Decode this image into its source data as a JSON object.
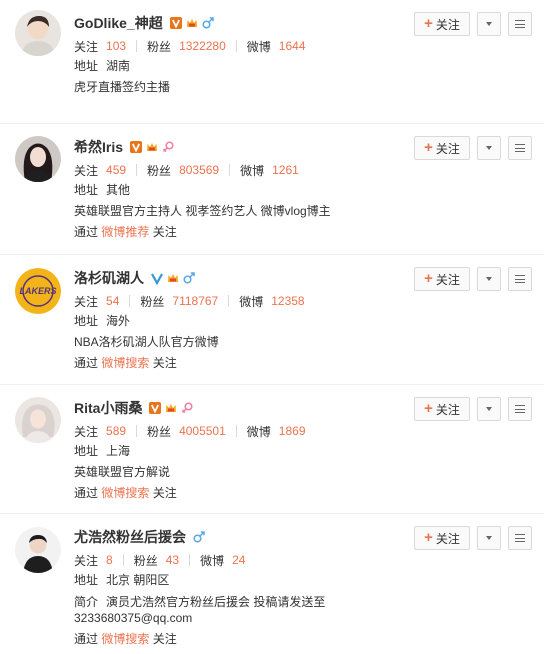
{
  "actions": {
    "follow_label": "关注"
  },
  "labels": {
    "follows": "关注",
    "fans": "粉丝",
    "posts": "微博",
    "location": "地址",
    "intro": "简介",
    "via": "通过",
    "follow_suffix": "关注"
  },
  "users": [
    {
      "name": "GoDlike_神超",
      "follows": "103",
      "fans": "1322280",
      "posts": "1644",
      "location": "湖南",
      "desc": "虎牙直播签约主播",
      "via_link": "",
      "badges": [
        "v-orange",
        "crown",
        "male"
      ]
    },
    {
      "name": "希然Iris",
      "follows": "459",
      "fans": "803569",
      "posts": "1261",
      "location": "其他",
      "desc": "英雄联盟官方主持人 视孝签约艺人 微博vlog博主",
      "via_link": "微博推荐",
      "badges": [
        "v-orange",
        "crown",
        "female"
      ]
    },
    {
      "name": "洛杉矶湖人",
      "follows": "54",
      "fans": "7118767",
      "posts": "12358",
      "location": "海外",
      "desc": "NBA洛杉矶湖人队官方微博",
      "via_link": "微博搜索",
      "badges": [
        "v-blue",
        "crown",
        "male"
      ]
    },
    {
      "name": "Rita小雨桑",
      "follows": "589",
      "fans": "4005501",
      "posts": "1869",
      "location": "上海",
      "desc": "英雄联盟官方解说",
      "via_link": "微博搜索",
      "badges": [
        "v-orange",
        "crown",
        "female"
      ]
    },
    {
      "name": "尤浩然粉丝后援会",
      "follows": "8",
      "fans": "43",
      "posts": "24",
      "location": "北京 朝阳区",
      "desc": "演员尤浩然官方粉丝后援会 投稿请发送至3233680375@qq.com",
      "via_link": "微博搜索",
      "badges": [
        "male"
      ]
    }
  ]
}
